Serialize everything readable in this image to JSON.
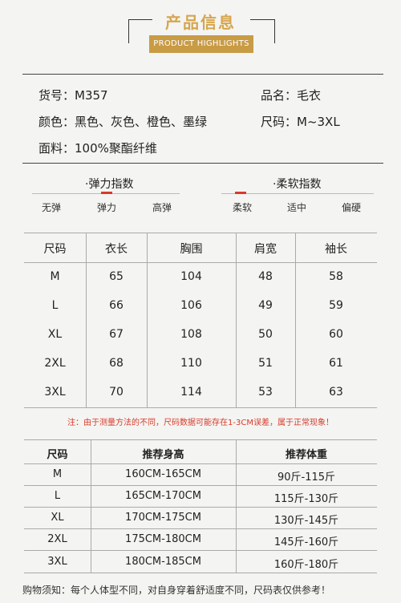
{
  "header": {
    "title": "产品信息",
    "subtitle": "PRODUCT HIGHLIGHTS"
  },
  "info": {
    "item_no": "货号：M357",
    "name": "品名：毛衣",
    "colors": "颜色：黑色、灰色、橙色、墨绿",
    "sizes": "尺码：M~3XL",
    "fabric": "面料：100%聚酯纤维"
  },
  "elasticity": {
    "title": "·弹力指数",
    "labels": [
      "无弹",
      "弹力",
      "高弹"
    ],
    "selected_index": 1
  },
  "softness": {
    "title": "·柔软指数",
    "labels": [
      "柔软",
      "适中",
      "偏硬"
    ],
    "selected_index": 0
  },
  "size_table": {
    "headers": [
      "尺码",
      "衣长",
      "胸围",
      "肩宽",
      "袖长"
    ],
    "rows": [
      [
        "M",
        "65",
        "104",
        "48",
        "58"
      ],
      [
        "L",
        "66",
        "106",
        "49",
        "59"
      ],
      [
        "XL",
        "67",
        "108",
        "50",
        "60"
      ],
      [
        "2XL",
        "68",
        "110",
        "51",
        "61"
      ],
      [
        "3XL",
        "70",
        "114",
        "53",
        "63"
      ]
    ]
  },
  "note": "注：由于测量方法的不同，尺码数据可能存在1-3CM误差，属于正常现象！",
  "recommend_table": {
    "headers": [
      "尺码",
      "推荐身高",
      "推荐体重"
    ],
    "rows": [
      [
        "M",
        "160CM-165CM",
        "90斤-115斤"
      ],
      [
        "L",
        "165CM-170CM",
        "115斤-130斤"
      ],
      [
        "XL",
        "170CM-175CM",
        "130斤-145斤"
      ],
      [
        "2XL",
        "175CM-180CM",
        "145斤-160斤"
      ],
      [
        "3XL",
        "180CM-185CM",
        "160斤-180斤"
      ]
    ]
  },
  "footer": "购物须知：每个人体型不同，对自身穿着舒适度不同，尺码表仅供参考！",
  "colors": {
    "gold": "#c89b45",
    "title_gold": "#d6a64e",
    "accent_red": "#d83a2a"
  }
}
